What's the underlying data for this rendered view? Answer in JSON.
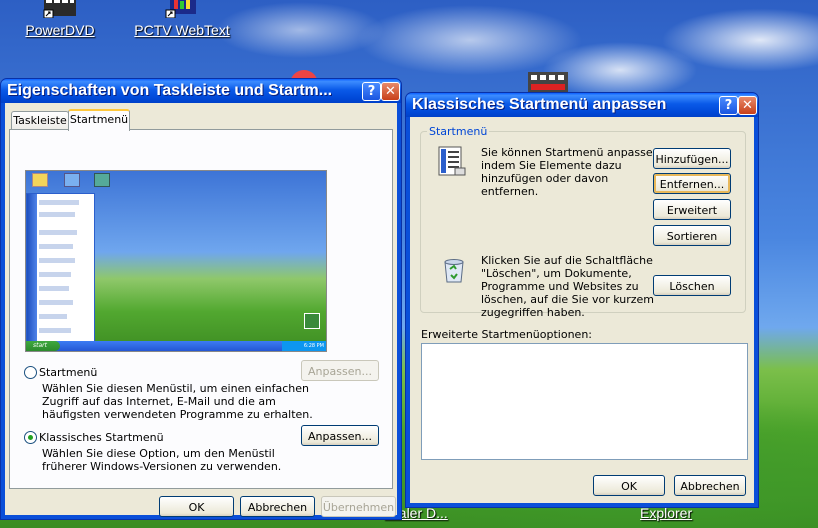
{
  "desktop": {
    "icons": [
      {
        "label": "PowerDVD"
      },
      {
        "label": "PCTV WebText"
      }
    ],
    "bottom_labels": [
      "okaler D...",
      "Explorer"
    ]
  },
  "taskbar_props": {
    "title": "Eigenschaften von Taskleiste und Startm...",
    "help_glyph": "?",
    "close_glyph": "✕",
    "tabs": [
      "Taskleiste",
      "Startmenü"
    ],
    "preview": {
      "start_label": "start",
      "clock": "6:28 PM"
    },
    "option_startmenu": {
      "label": "Startmenü",
      "description": [
        "Wählen Sie diesen Menüstil, um einen einfachen",
        "Zugriff auf das Internet, E-Mail und die am",
        "häufigsten verwendeten Programme zu erhalten."
      ],
      "customize_label": "Anpassen...",
      "selected": false
    },
    "option_classic": {
      "label": "Klassisches Startmenü",
      "description": [
        "Wählen Sie diese Option, um den Menüstil",
        "früherer Windows-Versionen zu verwenden."
      ],
      "customize_label": "Anpassen...",
      "selected": true
    },
    "buttons": {
      "ok": "OK",
      "cancel": "Abbrechen",
      "apply": "Übernehmen"
    }
  },
  "classic_dialog": {
    "title": "Klassisches Startmenü anpassen",
    "help_glyph": "?",
    "close_glyph": "✕",
    "group_label": "Startmenü",
    "customize_text": [
      "Sie können Startmenü anpassen,",
      "indem Sie Elemente dazu",
      "hinzufügen oder davon",
      "entfernen."
    ],
    "buttons_top": {
      "add": "Hinzufügen...",
      "remove": "Entfernen...",
      "advanced": "Erweitert",
      "sort": "Sortieren"
    },
    "clear_text": [
      "Klicken Sie auf die Schaltfläche",
      "\"Löschen\", um Dokumente,",
      "Programme und Websites zu",
      "löschen, auf die Sie vor kurzem",
      "zugegriffen haben."
    ],
    "clear_button": "Löschen",
    "advanced_options_label": "Erweiterte Startmenüoptionen:",
    "buttons": {
      "ok": "OK",
      "cancel": "Abbrechen"
    }
  }
}
